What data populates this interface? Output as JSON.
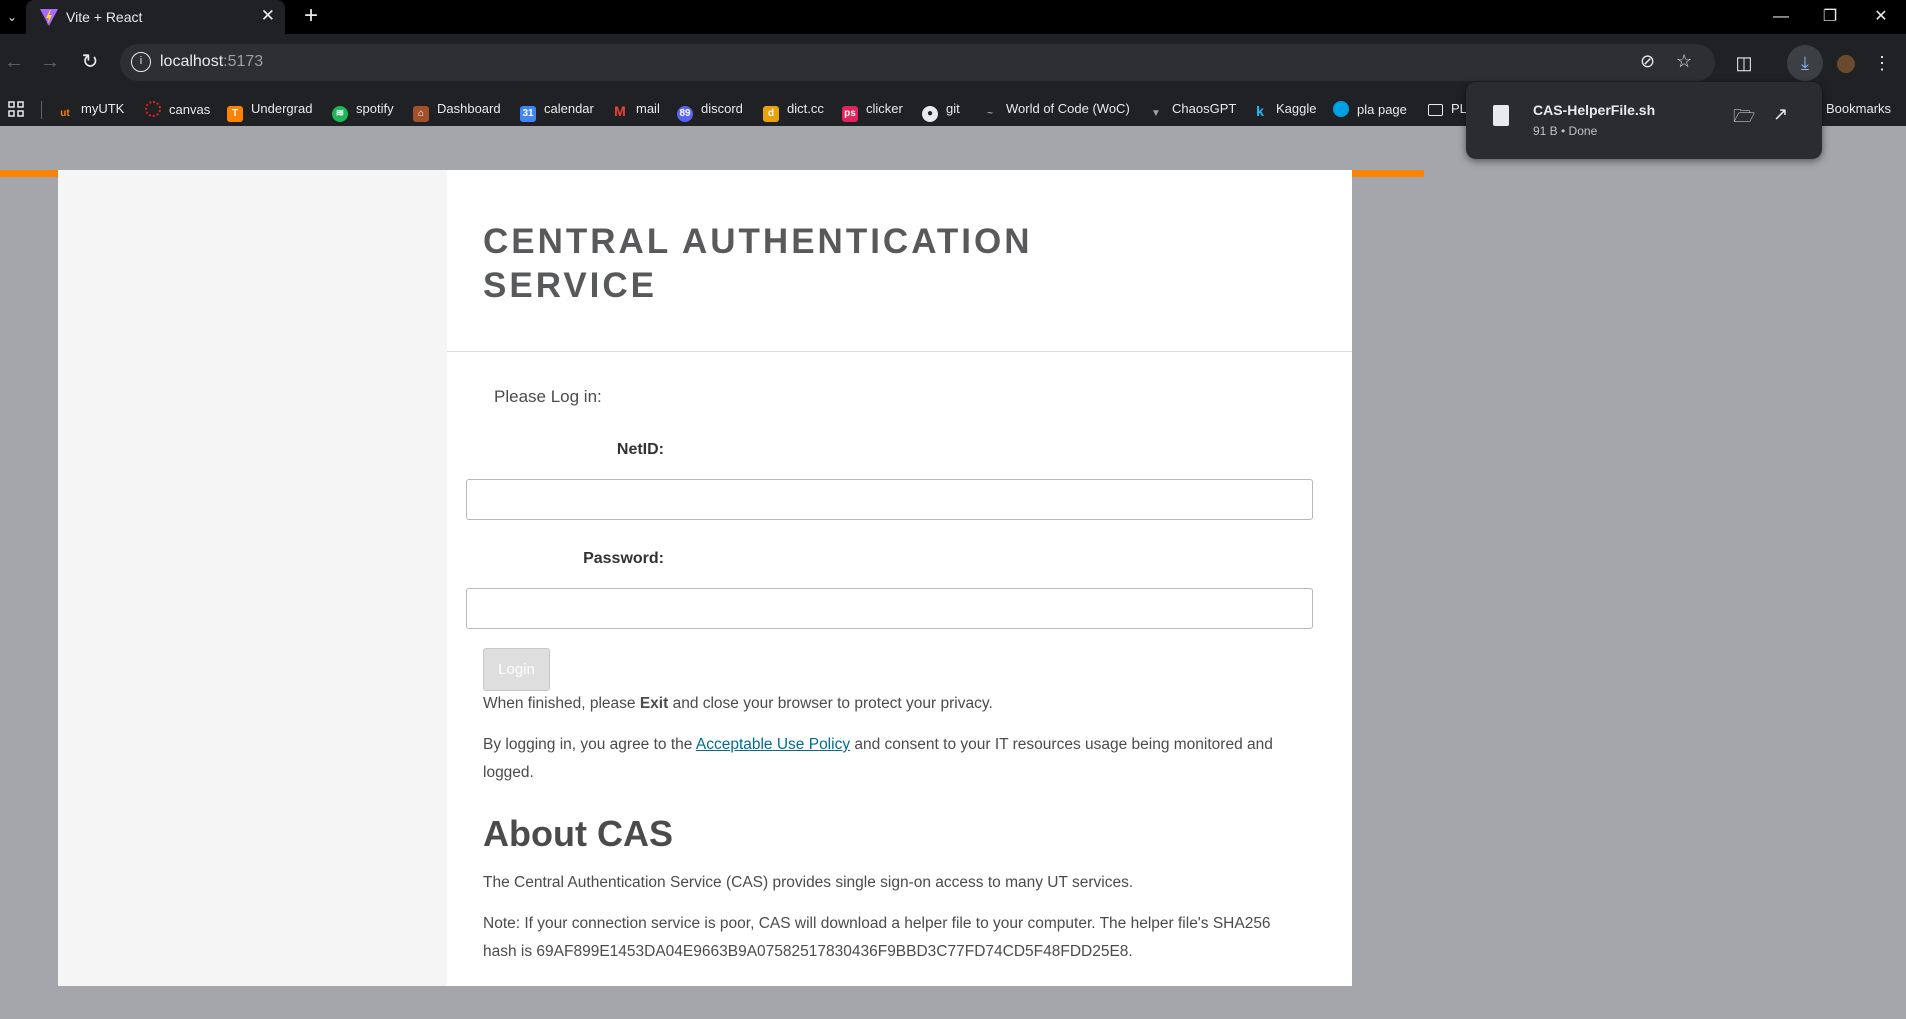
{
  "browser": {
    "tab_title": "Vite + React",
    "url_host": "localhost",
    "url_port": ":5173",
    "bookmarks": [
      "myUTK",
      "canvas",
      "Undergrad",
      "spotify",
      "Dashboard",
      "calendar",
      "mail",
      "discord",
      "dict.cc",
      "clicker",
      "git",
      "World of Code (WoC)",
      "ChaosGPT",
      "Kaggle",
      "pla page",
      "PL"
    ],
    "bookmarks_folder": "Bookmarks"
  },
  "downloads": {
    "filename": "CAS-HelperFile.sh",
    "status": "91 B • Done"
  },
  "page": {
    "title": "CENTRAL AUTHENTICATION SERVICE",
    "login_prompt": "Please Log in:",
    "netid_label": "NetID:",
    "password_label": "Password:",
    "login_button": "Login",
    "exit_para": {
      "before": "When finished, please ",
      "bold": "Exit",
      "after": " and close your browser to protect your privacy."
    },
    "policy_para": {
      "before": "By logging in, you agree to the ",
      "link": "Acceptable Use Policy",
      "after": " and consent to your IT resources usage being monitored and logged."
    },
    "about_heading": "About CAS",
    "about_text": "The Central Authentication Service (CAS) provides single sign-on access to many UT services.",
    "note_text": "Note: If your connection service is poor, CAS will download a helper file to your computer. The helper file's SHA256 hash is 69AF899E1453DA04E9663B9A07582517830436F9BBD3C77FD74CD5F48FDD25E8."
  },
  "colors": {
    "accent_orange": "#ff8200",
    "link": "#006c93",
    "page_bg": "#a5a6ab"
  }
}
